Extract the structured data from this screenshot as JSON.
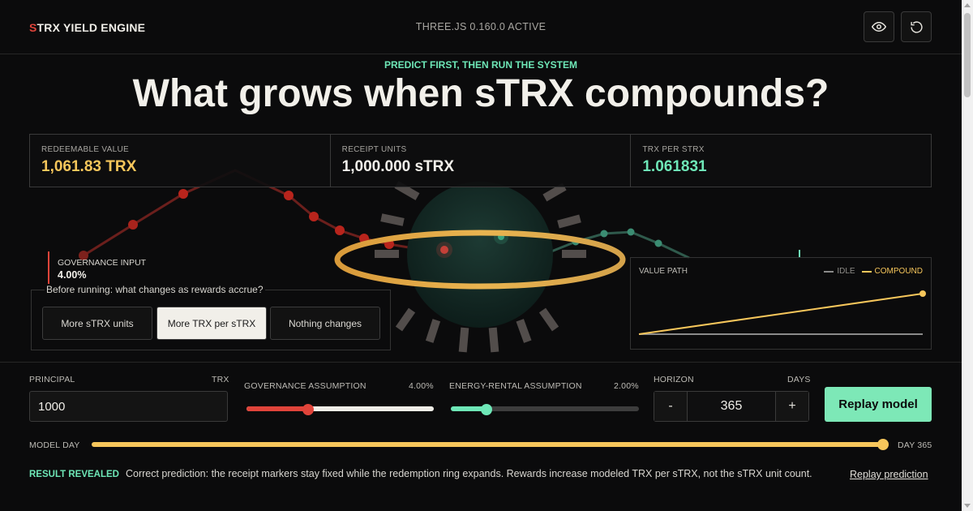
{
  "header": {
    "brand_initial": "S",
    "brand_rest": "TRX YIELD ENGINE",
    "engine_status": "THREE.JS 0.160.0 ACTIVE",
    "icons": [
      "eye-icon",
      "reset-icon"
    ]
  },
  "hero": {
    "kicker": "PREDICT FIRST, THEN RUN THE SYSTEM",
    "headline": "What grows when sTRX compounds?"
  },
  "metrics": [
    {
      "label": "REDEEMABLE VALUE",
      "value": "1,061.83 TRX",
      "color": "#f6c65b"
    },
    {
      "label": "RECEIPT UNITS",
      "value": "1,000.000 sTRX",
      "color": "#f2f0ea"
    },
    {
      "label": "TRX PER STRX",
      "value": "1.061831",
      "color": "#6ee7b7"
    }
  ],
  "governance_input": {
    "label": "GOVERNANCE INPUT",
    "value": "4.00%"
  },
  "prediction": {
    "question": "Before running: what changes as rewards accrue?",
    "options": [
      {
        "label": "More sTRX units",
        "selected": false
      },
      {
        "label": "More TRX per sTRX",
        "selected": true
      },
      {
        "label": "Nothing changes",
        "selected": false
      }
    ]
  },
  "value_path": {
    "title": "VALUE PATH",
    "legend_idle": "IDLE",
    "legend_compound": "COMPOUND",
    "chart_data": {
      "type": "line",
      "series": [
        {
          "name": "IDLE",
          "color": "#8a8a8a",
          "values": [
            0,
            0
          ]
        },
        {
          "name": "COMPOUND",
          "color": "#f6c65b",
          "values": [
            0,
            1
          ]
        }
      ]
    }
  },
  "controls": {
    "principal": {
      "label": "PRINCIPAL",
      "unit": "TRX",
      "value": "1000"
    },
    "governance": {
      "label": "GOVERNANCE ASSUMPTION",
      "value_text": "4.00%",
      "fraction": 0.33,
      "color": "#e0443a"
    },
    "energy": {
      "label": "ENERGY-RENTAL ASSUMPTION",
      "value_text": "2.00%",
      "fraction": 0.19,
      "color": "#6ee7b7"
    },
    "horizon": {
      "label": "HORIZON",
      "unit": "DAYS",
      "value": "365",
      "minus": "-",
      "plus": "+"
    },
    "replay_button": "Replay model",
    "model_day": {
      "label": "MODEL DAY",
      "value_text": "DAY 365",
      "fraction": 1.0
    }
  },
  "result": {
    "badge": "RESULT REVEALED",
    "text": "Correct prediction: the receipt markers stay fixed while the redemption ring expands. Rewards increase modeled TRX per sTRX, not the sTRX unit count.",
    "link": "Replay prediction"
  }
}
